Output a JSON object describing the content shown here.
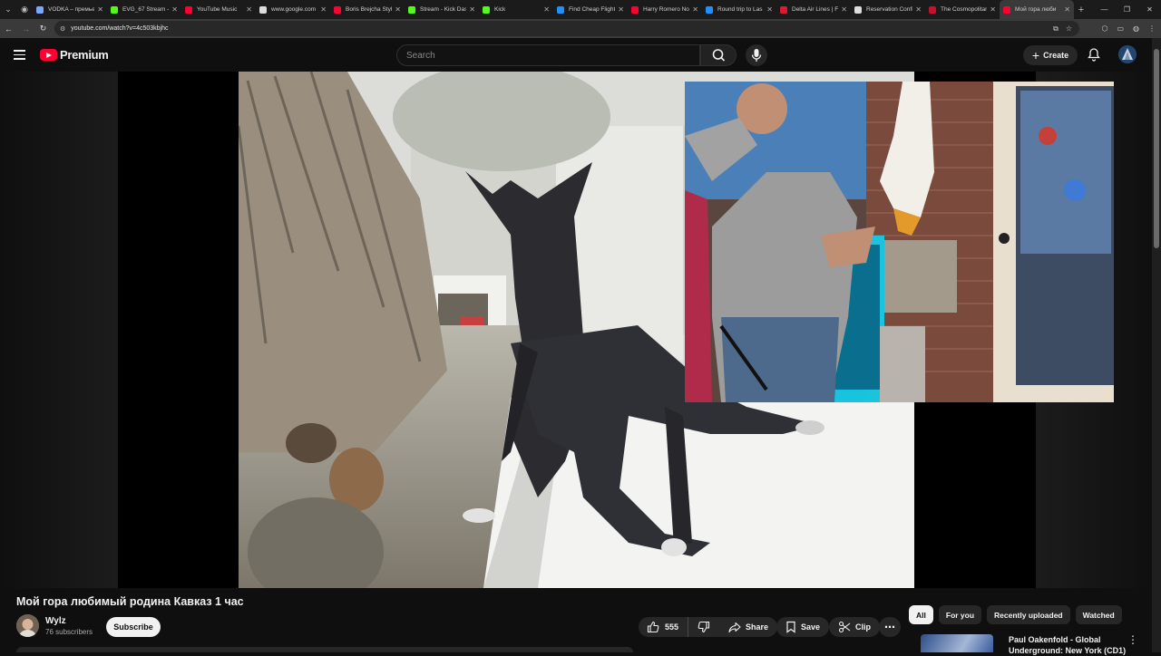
{
  "browser": {
    "tabs": [
      {
        "title": "VODKA – премьер",
        "color": "#7aa7ff"
      },
      {
        "title": "EVG_67 Stream - Kick",
        "color": "#53fc18"
      },
      {
        "title": "YouTube Music",
        "color": "#ff0033"
      },
      {
        "title": "www.google.com",
        "color": "#dddddd"
      },
      {
        "title": "Boris Brejcha Style",
        "color": "#ff0033"
      },
      {
        "title": "Stream - Kick Dashb",
        "color": "#53fc18"
      },
      {
        "title": "Kick",
        "color": "#53fc18"
      },
      {
        "title": "Find Cheap Flights",
        "color": "#1e90ff"
      },
      {
        "title": "Harry Romero No",
        "color": "#ff0033"
      },
      {
        "title": "Round trip to Las",
        "color": "#1e90ff"
      },
      {
        "title": "Delta Air Lines | Fl",
        "color": "#e01933"
      },
      {
        "title": "Reservation Confirm",
        "color": "#dddddd"
      },
      {
        "title": "The Cosmopolitan",
        "color": "#c8102e"
      },
      {
        "title": "Мой гора люби",
        "color": "#ff0033"
      }
    ],
    "url": "youtube.com/watch?v=4c503kbjhc"
  },
  "header": {
    "logo_text": "Premium",
    "search_placeholder": "Search",
    "create_label": "Create"
  },
  "video": {
    "title": "Мой гора любимый родина Кавказ 1 час",
    "channel_name": "Wylz",
    "subscribers": "76 subscribers",
    "subscribe_label": "Subscribe",
    "like_count": "555",
    "share_label": "Share",
    "save_label": "Save",
    "clip_label": "Clip"
  },
  "sidebar": {
    "chips": [
      "All",
      "For you",
      "Recently uploaded",
      "Watched"
    ],
    "recommendation_title": "Paul Oakenfold - Global Underground: New York (CD1)"
  },
  "colors": {
    "background": "#0f0f0f",
    "brand_red": "#ff0033",
    "pill": "#272727"
  }
}
